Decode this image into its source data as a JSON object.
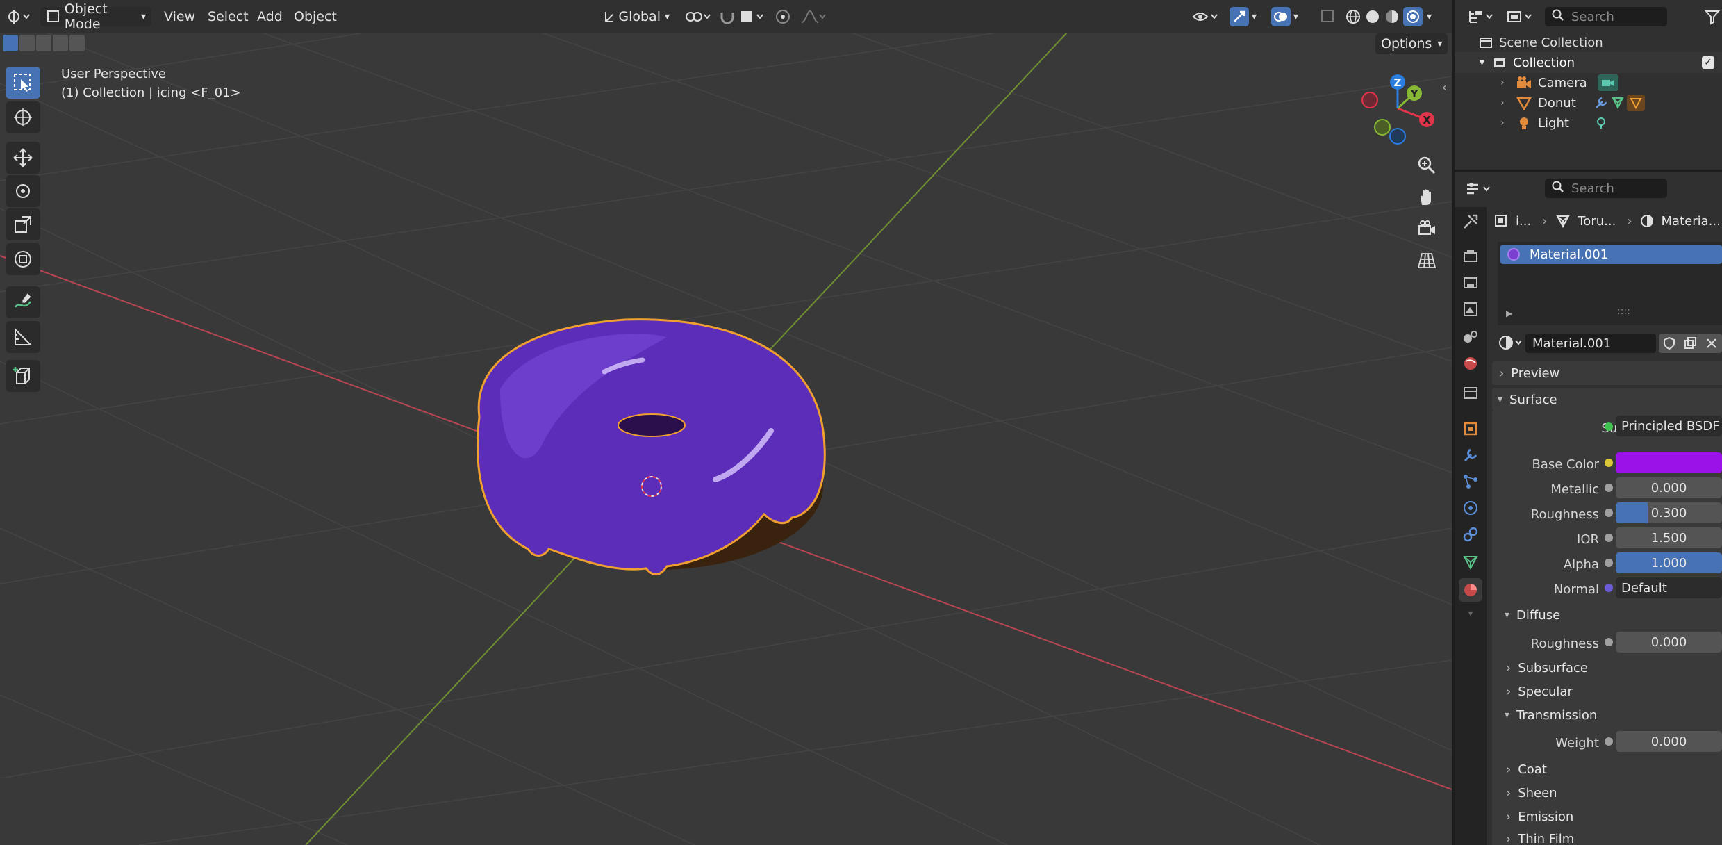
{
  "header": {
    "mode": "Object Mode",
    "menus": [
      "View",
      "Select",
      "Add",
      "Object"
    ],
    "orientation": "Global",
    "options_label": "Options"
  },
  "viewport": {
    "view_name": "User Perspective",
    "collection_info": "(1) Collection | icing <F_01>",
    "gizmo_axes": {
      "x": "X",
      "y": "Y",
      "z": "Z"
    }
  },
  "outliner": {
    "search_placeholder": "Search",
    "scene_collection": "Scene Collection",
    "collection": "Collection",
    "items": [
      {
        "label": "Camera"
      },
      {
        "label": "Donut"
      },
      {
        "label": "Light"
      }
    ]
  },
  "properties": {
    "search_placeholder": "Search",
    "breadcrumb": [
      "i...",
      "Toru...",
      "Materia..."
    ],
    "material_slot": "Material.001",
    "material_name": "Material.001",
    "sections": {
      "preview": "Preview",
      "surface": "Surface",
      "diffuse": "Diffuse",
      "subsurface": "Subsurface",
      "specular": "Specular",
      "transmission": "Transmission",
      "coat": "Coat",
      "sheen": "Sheen",
      "emission": "Emission",
      "thin_film": "Thin Film"
    },
    "fields": {
      "surface_label": "Surface",
      "surface_value": "Principled BSDF",
      "base_color_label": "Base Color",
      "base_color": "#9a12e8",
      "metallic_label": "Metallic",
      "metallic": "0.000",
      "roughness_label": "Roughness",
      "roughness": "0.300",
      "roughness_fraction": 0.3,
      "ior_label": "IOR",
      "ior": "1.500",
      "alpha_label": "Alpha",
      "alpha": "1.000",
      "normal_label": "Normal",
      "normal_value": "Default",
      "diffuse_roughness_label": "Roughness",
      "diffuse_roughness": "0.000",
      "weight_label": "Weight",
      "weight": "0.000"
    }
  },
  "colors": {
    "accent": "#4772b3",
    "selection_outline": "#f0a030",
    "donut_icing": "#6a2ec8",
    "x_axis": "#e2344a",
    "y_axis": "#86b833",
    "z_axis": "#2b7de0"
  }
}
